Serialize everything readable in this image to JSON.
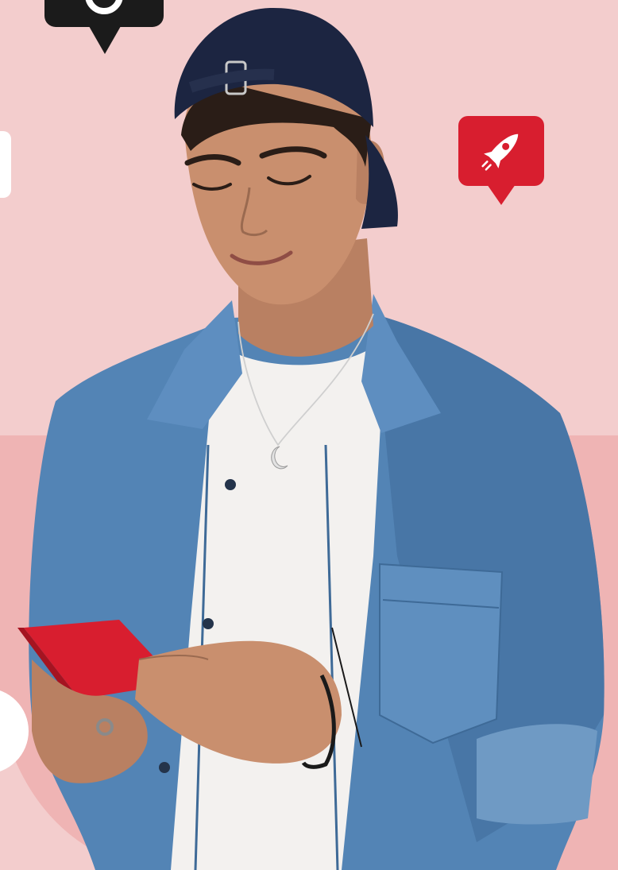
{
  "scene": {
    "description_free": true,
    "colors": {
      "background_top": "#f3cdcd",
      "background_bottom": "#efb2b2",
      "accent_red": "#d81e2f",
      "bubble_black": "#1b1b1b",
      "bubble_white": "#ffffff",
      "cap_navy": "#1c2541",
      "denim": "#4f7fb1",
      "denim_dark": "#3b6592",
      "tshirt": "#f3f1ef",
      "skin": "#c98f6e",
      "hair": "#2a1d17"
    },
    "icons": [
      {
        "name": "chat-bubble-black-icon"
      },
      {
        "name": "rocket-bubble-icon"
      },
      {
        "name": "partial-white-card-icon"
      },
      {
        "name": "partial-white-circle-icon"
      }
    ],
    "person": {
      "holding": "smartphone",
      "phone_color": "#d81e2f"
    }
  }
}
